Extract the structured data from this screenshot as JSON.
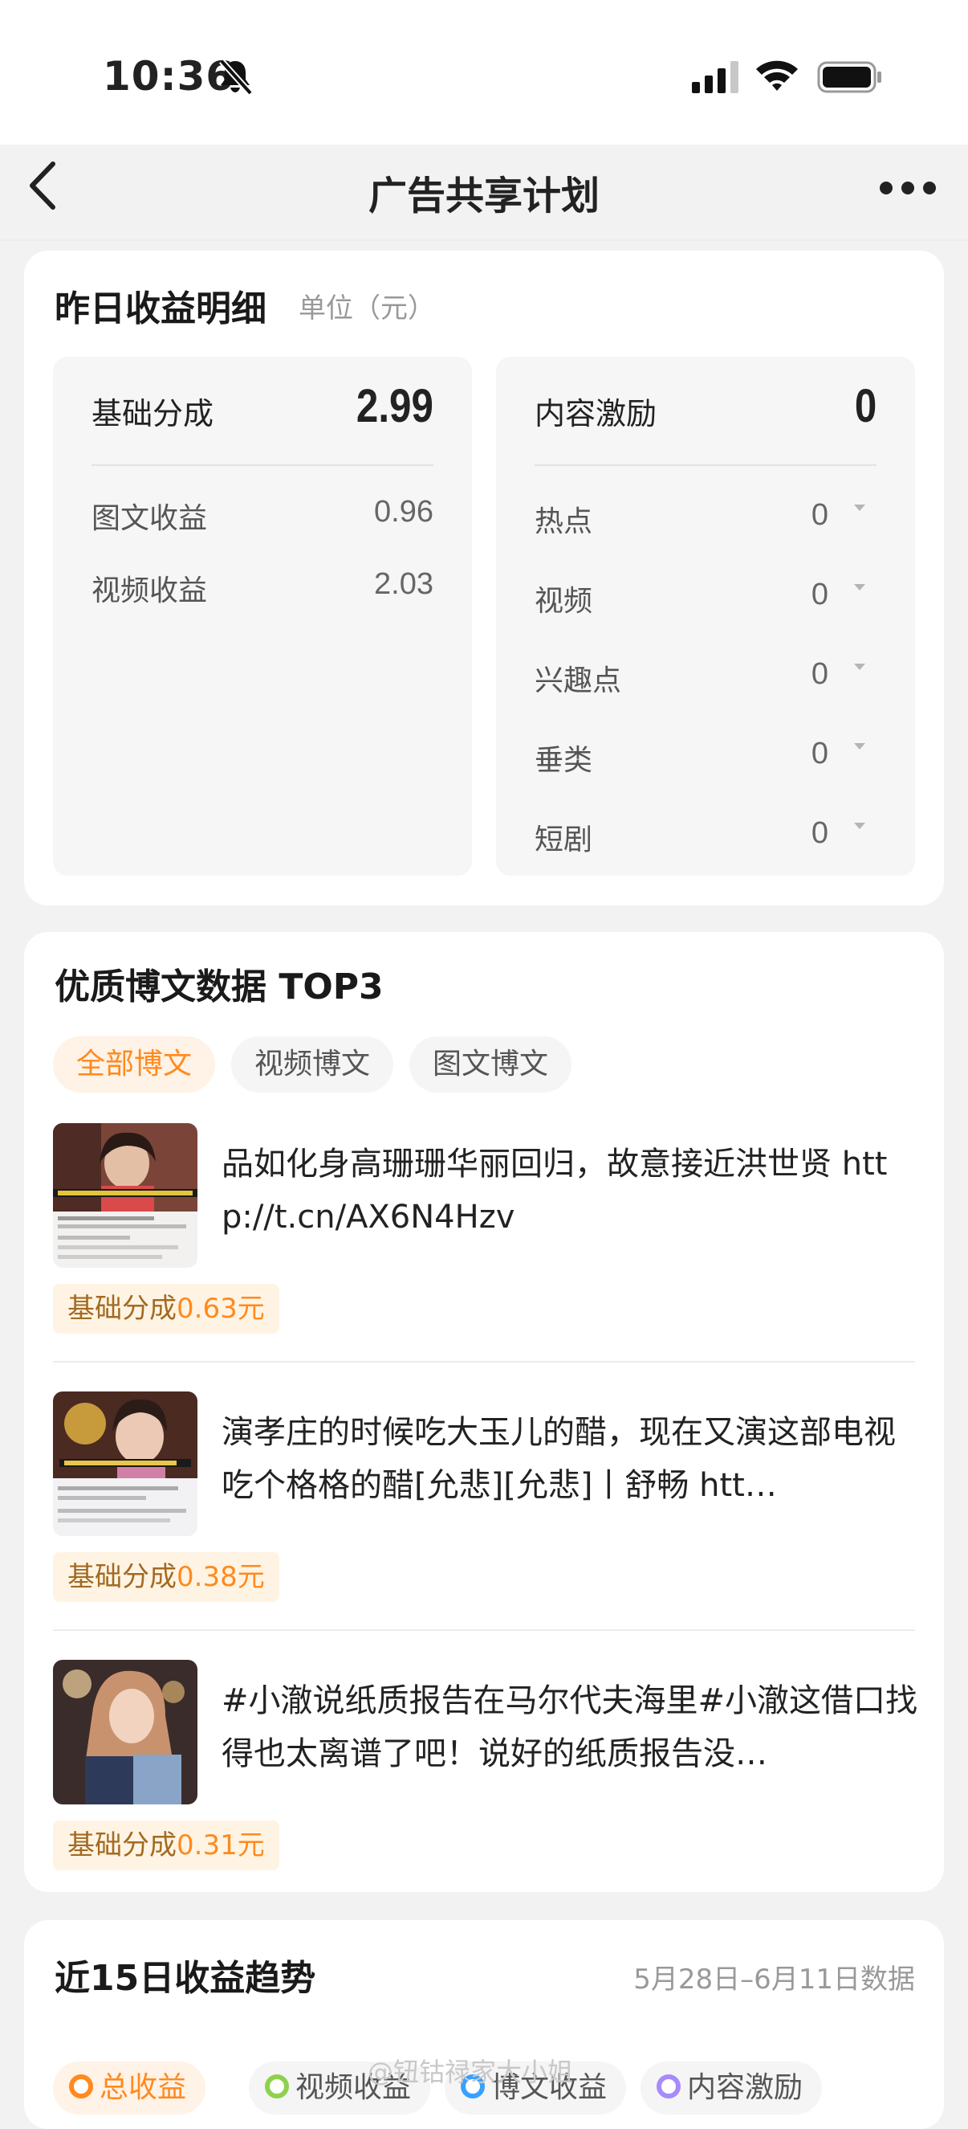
{
  "status": {
    "time": "10:36"
  },
  "nav": {
    "title": "广告共享计划"
  },
  "yesterday": {
    "title": "昨日收益明细",
    "unit": "单位（元）",
    "basic": {
      "label": "基础分成",
      "value": "2.99",
      "rows": [
        {
          "label": "图文收益",
          "value": "0.96"
        },
        {
          "label": "视频收益",
          "value": "2.03"
        }
      ]
    },
    "incentive": {
      "label": "内容激励",
      "value": "0",
      "rows": [
        {
          "label": "热点",
          "value": "0"
        },
        {
          "label": "视频",
          "value": "0"
        },
        {
          "label": "兴趣点",
          "value": "0"
        },
        {
          "label": "垂类",
          "value": "0"
        },
        {
          "label": "短剧",
          "value": "0"
        }
      ]
    }
  },
  "top3": {
    "title": "优质博文数据 TOP3",
    "tabs": [
      "全部博文",
      "视频博文",
      "图文博文"
    ],
    "posts": [
      {
        "text": "品如化身高珊珊华丽回归，故意接近洪世贤 http://t.cn/AX6N4Hzv",
        "badge_label": "基础分成",
        "badge_value": "0.63元"
      },
      {
        "text": "演孝庄的时候吃大玉儿的醋，现在又演这部电视吃个格格的醋[允悲][允悲]丨舒畅 htt…",
        "badge_label": "基础分成",
        "badge_value": "0.38元"
      },
      {
        "text": "#小澈说纸质报告在马尔代夫海里#小澈这借口找得也太离谱了吧！说好的纸质报告没…",
        "badge_label": "基础分成",
        "badge_value": "0.31元"
      }
    ]
  },
  "trend": {
    "title": "近15日收益趋势",
    "range": "5月28日–6月11日数据",
    "legends": [
      {
        "label": "总收益",
        "color": "#ff8a1e"
      },
      {
        "label": "视频收益",
        "color": "#8fd14f"
      },
      {
        "label": "博文收益",
        "color": "#3aa0ff"
      },
      {
        "label": "内容激励",
        "color": "#a78bfa"
      }
    ]
  },
  "watermark": "@钮钴禄家大小姐"
}
